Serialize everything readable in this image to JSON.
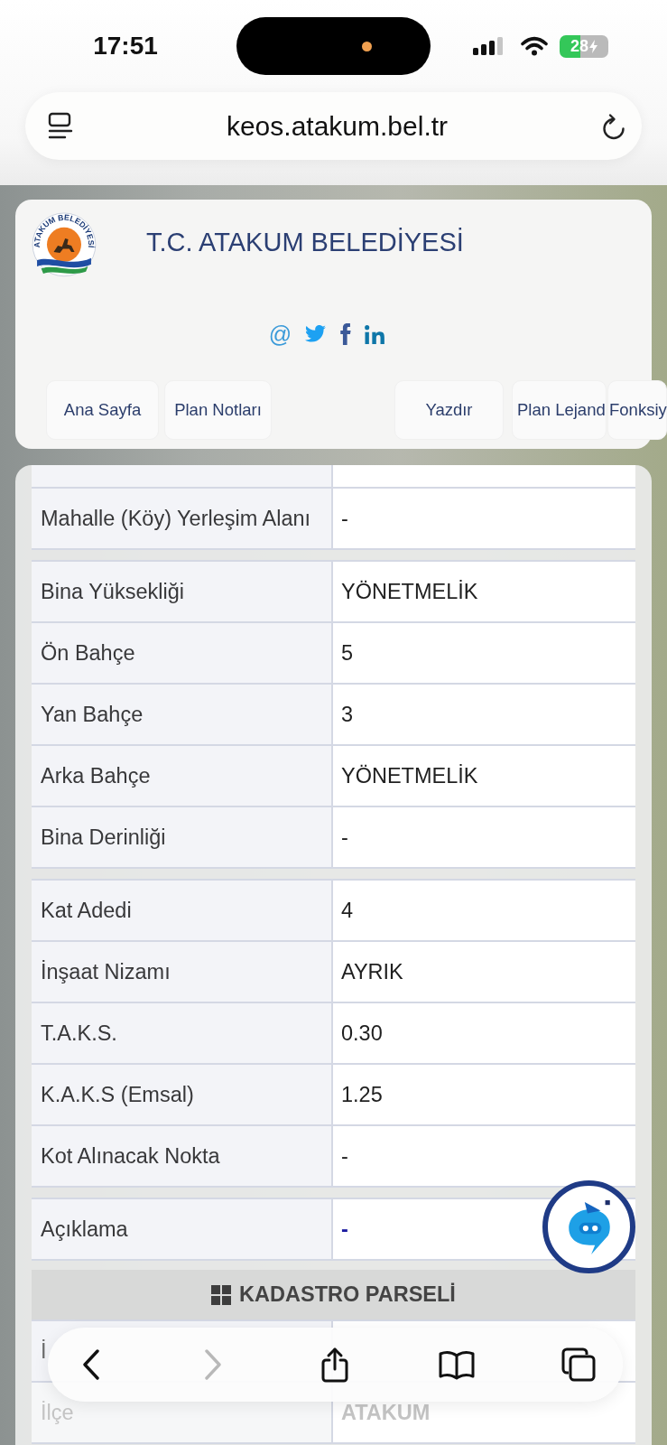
{
  "status_bar": {
    "time": "17:51",
    "battery": "28"
  },
  "address_bar": {
    "url": "keos.atakum.bel.tr"
  },
  "site_header": {
    "logo_ring_text": "ATAKUM BELEDİYESİ",
    "title": "T.C. ATAKUM BELEDİYESİ",
    "social_links": [
      {
        "kind": "email",
        "glyph": "@"
      },
      {
        "kind": "twitter"
      },
      {
        "kind": "facebook"
      },
      {
        "kind": "linkedin"
      }
    ],
    "nav": [
      {
        "label": "Ana Sayfa"
      },
      {
        "label": "Plan Notları"
      },
      {
        "label": "Yazdır"
      },
      {
        "label": "Plan Lejand"
      },
      {
        "label": "Fonksiy"
      }
    ]
  },
  "table": {
    "groups": [
      {
        "rows": [
          {
            "kind": "clipped"
          },
          {
            "kind": "text",
            "label": "Mahalle (Köy) Yerleşim Alanı",
            "value": "-"
          }
        ]
      },
      {
        "rows": [
          {
            "kind": "text",
            "label": "Bina Yüksekliği",
            "value": "YÖNETMELİK"
          },
          {
            "kind": "text",
            "label": "Ön Bahçe",
            "value": "5"
          },
          {
            "kind": "text",
            "label": "Yan Bahçe",
            "value": "3"
          },
          {
            "kind": "text",
            "label": "Arka Bahçe",
            "value": "YÖNETMELİK"
          },
          {
            "kind": "text",
            "label": "Bina Derinliği",
            "value": "-"
          }
        ]
      },
      {
        "rows": [
          {
            "kind": "text",
            "label": "Kat Adedi",
            "value": "4"
          },
          {
            "kind": "text",
            "label": "İnşaat Nizamı",
            "value": "AYRIK"
          },
          {
            "kind": "text",
            "label": "T.A.K.S.",
            "value": "0.30"
          },
          {
            "kind": "text",
            "label": "K.A.K.S (Emsal)",
            "value": "1.25"
          },
          {
            "kind": "text",
            "label": "Kot Alınacak Nokta",
            "value": "-"
          }
        ]
      },
      {
        "rows": [
          {
            "kind": "link",
            "label": "Açıklama",
            "value": "-"
          }
        ]
      }
    ]
  },
  "parcel_section": {
    "title": "KADASTRO PARSELİ",
    "rows": [
      {
        "kind": "covered",
        "label": "İ"
      },
      {
        "kind": "faded",
        "label": "İlçe",
        "value": "ATAKUM"
      }
    ]
  },
  "browser_toolbar": {
    "buttons": [
      {
        "kind": "back",
        "disabled": false
      },
      {
        "kind": "forward",
        "disabled": true
      },
      {
        "kind": "share",
        "disabled": false
      },
      {
        "kind": "bookmarks",
        "disabled": false
      },
      {
        "kind": "tabs",
        "disabled": false
      }
    ]
  }
}
